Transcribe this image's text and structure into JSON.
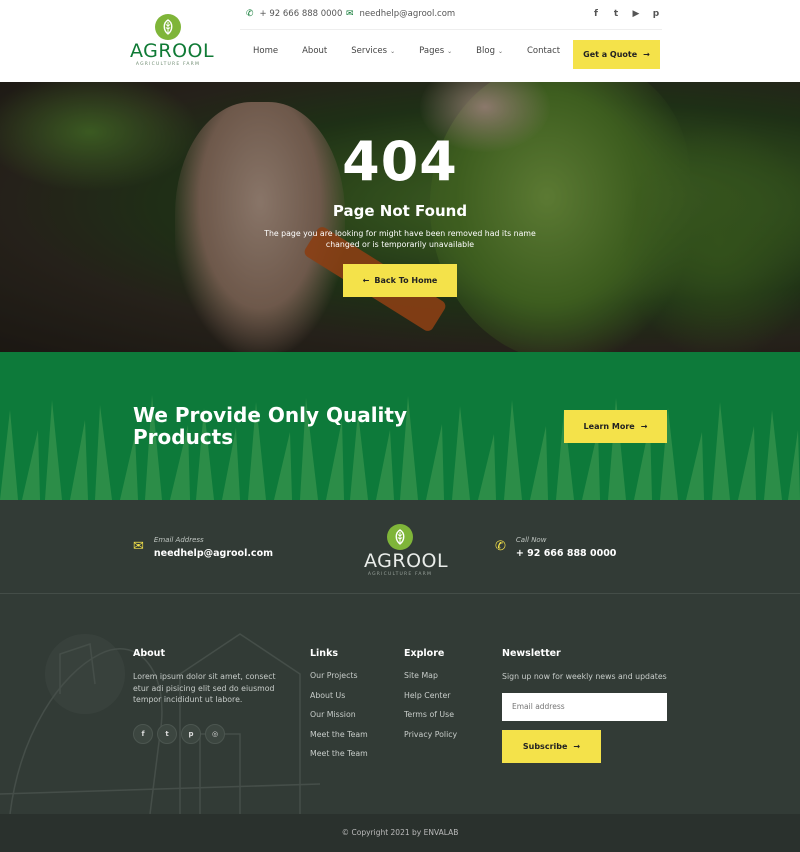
{
  "brand": {
    "name": "AGROOL",
    "tagline": "Agriculture Farm"
  },
  "topbar": {
    "phone": "+ 92 666 888 0000",
    "email": "needhelp@agrool.com",
    "socials": [
      "f",
      "t",
      "yt",
      "p"
    ]
  },
  "nav": {
    "items": [
      {
        "label": "Home",
        "dropdown": false
      },
      {
        "label": "About",
        "dropdown": false
      },
      {
        "label": "Services",
        "dropdown": true
      },
      {
        "label": "Pages",
        "dropdown": true
      },
      {
        "label": "Blog",
        "dropdown": true
      },
      {
        "label": "Contact",
        "dropdown": false
      }
    ],
    "quote_label": "Get a Quote"
  },
  "hero": {
    "code": "404",
    "title": "Page Not Found",
    "message": "The page you are looking for might have been removed had its name changed or is temporarily unavailable",
    "button_label": "Back To Home"
  },
  "cta": {
    "title": "We Provide Only Quality Products",
    "button_label": "Learn More"
  },
  "footer": {
    "email_label": "Email Address",
    "email_value": "needhelp@agrool.com",
    "call_label": "Call Now",
    "call_value": "+ 92 666 888 0000",
    "about": {
      "heading": "About",
      "text": "Lorem ipsum dolor sit amet, consect etur adi pisicing elit sed do eiusmod tempor incididunt ut labore."
    },
    "links": {
      "heading": "Links",
      "items": [
        "Our Projects",
        "About Us",
        "Our Mission",
        "Meet the Team",
        "Meet the Team"
      ]
    },
    "explore": {
      "heading": "Explore",
      "items": [
        "Site Map",
        "Help Center",
        "Terms of Use",
        "Privacy Policy"
      ]
    },
    "newsletter": {
      "heading": "Newsletter",
      "text": "Sign up now for weekly news and updates",
      "placeholder": "Email address",
      "button_label": "Subscribe"
    },
    "copyright": "© Copyright 2021 by ENVALAB"
  },
  "colors": {
    "brand_green": "#0d7a3a",
    "accent_yellow": "#f4e24a",
    "footer_dark": "#323b36"
  }
}
